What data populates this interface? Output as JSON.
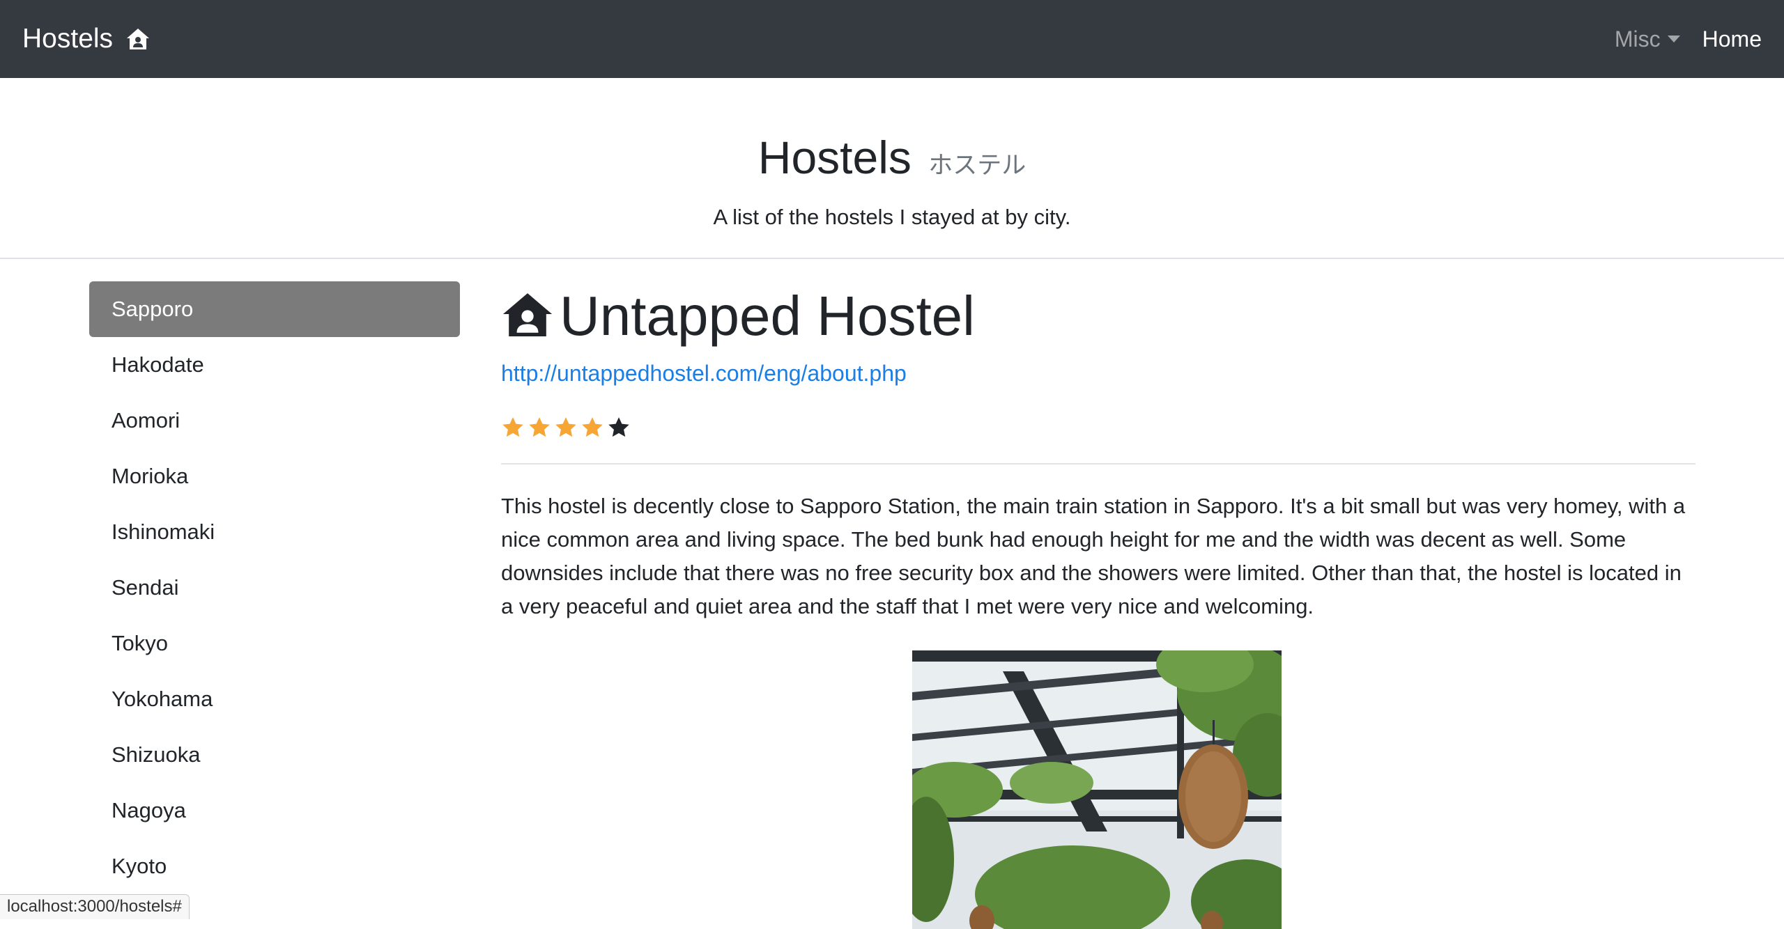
{
  "navbar": {
    "brand": "Hostels",
    "misc_label": "Misc",
    "home_label": "Home"
  },
  "header": {
    "title": "Hostels",
    "subtitle": "ホステル",
    "lead": "A list of the hostels I stayed at by city."
  },
  "sidebar": {
    "items": [
      {
        "label": "Sapporo",
        "active": true
      },
      {
        "label": "Hakodate"
      },
      {
        "label": "Aomori"
      },
      {
        "label": "Morioka"
      },
      {
        "label": "Ishinomaki"
      },
      {
        "label": "Sendai"
      },
      {
        "label": "Tokyo"
      },
      {
        "label": "Yokohama"
      },
      {
        "label": "Shizuoka"
      },
      {
        "label": "Nagoya"
      },
      {
        "label": "Kyoto"
      }
    ]
  },
  "hostel": {
    "name": "Untapped Hostel",
    "url": "http://untappedhostel.com/eng/about.php",
    "rating": 4,
    "rating_max": 5,
    "description": "This hostel is decently close to Sapporo Station, the main train station in Sapporo. It's a bit small but was very homey, with a nice common area and living space. The bed bunk had enough height for me and the width was decent as well. Some downsides include that there was no free security box and the showers were limited. Other than that, the hostel is located in a very peaceful and quiet area and the staff that I met were very nice and welcoming."
  },
  "status_bar": {
    "url": "localhost:3000/hostels#"
  },
  "colors": {
    "navbar_bg": "#343a40",
    "star_filled": "#f7a534",
    "star_empty": "#212529",
    "link": "#1a7ee6",
    "active_item_bg": "#7b7b7b"
  },
  "icons": {
    "brand_icon": "house-user-icon",
    "title_icon": "house-user-icon",
    "star_icon": "star-icon"
  }
}
